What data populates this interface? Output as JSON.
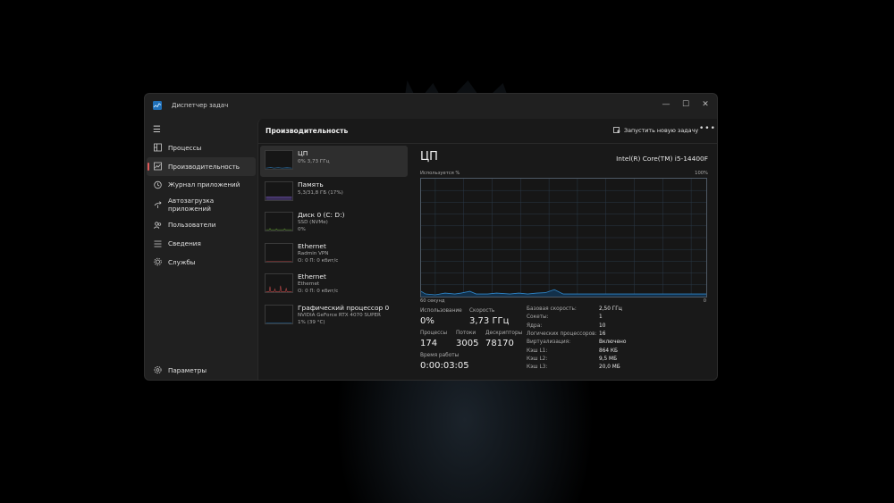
{
  "window": {
    "title": "Диспетчер задач"
  },
  "nav": {
    "items": [
      {
        "label": "Процессы",
        "icon": "processes-icon"
      },
      {
        "label": "Производительность",
        "icon": "performance-icon"
      },
      {
        "label": "Журнал приложений",
        "icon": "app-history-icon"
      },
      {
        "label": "Автозагрузка приложений",
        "icon": "startup-icon"
      },
      {
        "label": "Пользователи",
        "icon": "users-icon"
      },
      {
        "label": "Сведения",
        "icon": "details-icon"
      },
      {
        "label": "Службы",
        "icon": "services-icon"
      }
    ],
    "settings_label": "Параметры"
  },
  "header": {
    "title": "Производительность",
    "run_task_label": "Запустить новую задачу",
    "more_label": "•••"
  },
  "resources": [
    {
      "name": "ЦП",
      "sub1": "0% 3,73 ГГц",
      "sub2": ""
    },
    {
      "name": "Память",
      "sub1": "5,3/31,8 ГБ (17%)",
      "sub2": ""
    },
    {
      "name": "Диск 0 (C: D:)",
      "sub1": "SSD (NVMe)",
      "sub2": "0%"
    },
    {
      "name": "Ethernet",
      "sub1": "Radmin VPN",
      "sub2": "О: 0 П: 0 кбит/с"
    },
    {
      "name": "Ethernet",
      "sub1": "Ethernet",
      "sub2": "О: 0 П: 0 кбит/с"
    },
    {
      "name": "Графический процессор 0",
      "sub1": "NVIDIA GeForce RTX 4070 SUPER",
      "sub2": "1% (39 °C)"
    }
  ],
  "cpu": {
    "title": "ЦП",
    "model": "Intel(R) Core(TM) i5-14400F",
    "graph_label": "Используется %",
    "graph_max": "100%",
    "graph_time": "60 секунд",
    "graph_min": "0",
    "usage_label": "Использование",
    "usage_value": "0%",
    "speed_label": "Скорость",
    "speed_value": "3,73 ГГц",
    "processes_label": "Процессы",
    "processes_value": "174",
    "threads_label": "Потоки",
    "threads_value": "3005",
    "handles_label": "Дескрипторы",
    "handles_value": "78170",
    "uptime_label": "Время работы",
    "uptime_value": "0:00:03:05",
    "specs": [
      {
        "k": "Базовая скорость:",
        "v": "2,50 ГГц"
      },
      {
        "k": "Сокеты:",
        "v": "1"
      },
      {
        "k": "Ядра:",
        "v": "10"
      },
      {
        "k": "Логических процессоров:",
        "v": "16"
      },
      {
        "k": "Виртуализация:",
        "v": "Включено"
      },
      {
        "k": "Кэш L1:",
        "v": "864 КБ"
      },
      {
        "k": "Кэш L2:",
        "v": "9,5 МБ"
      },
      {
        "k": "Кэш L3:",
        "v": "20,0 МБ"
      }
    ]
  },
  "colors": {
    "accent_cpu": "#2f86c9",
    "memory": "#7a5ac0",
    "disk": "#6aa53a",
    "ethernet": "#c04a4a",
    "active_indicator": "#e05a5a"
  }
}
